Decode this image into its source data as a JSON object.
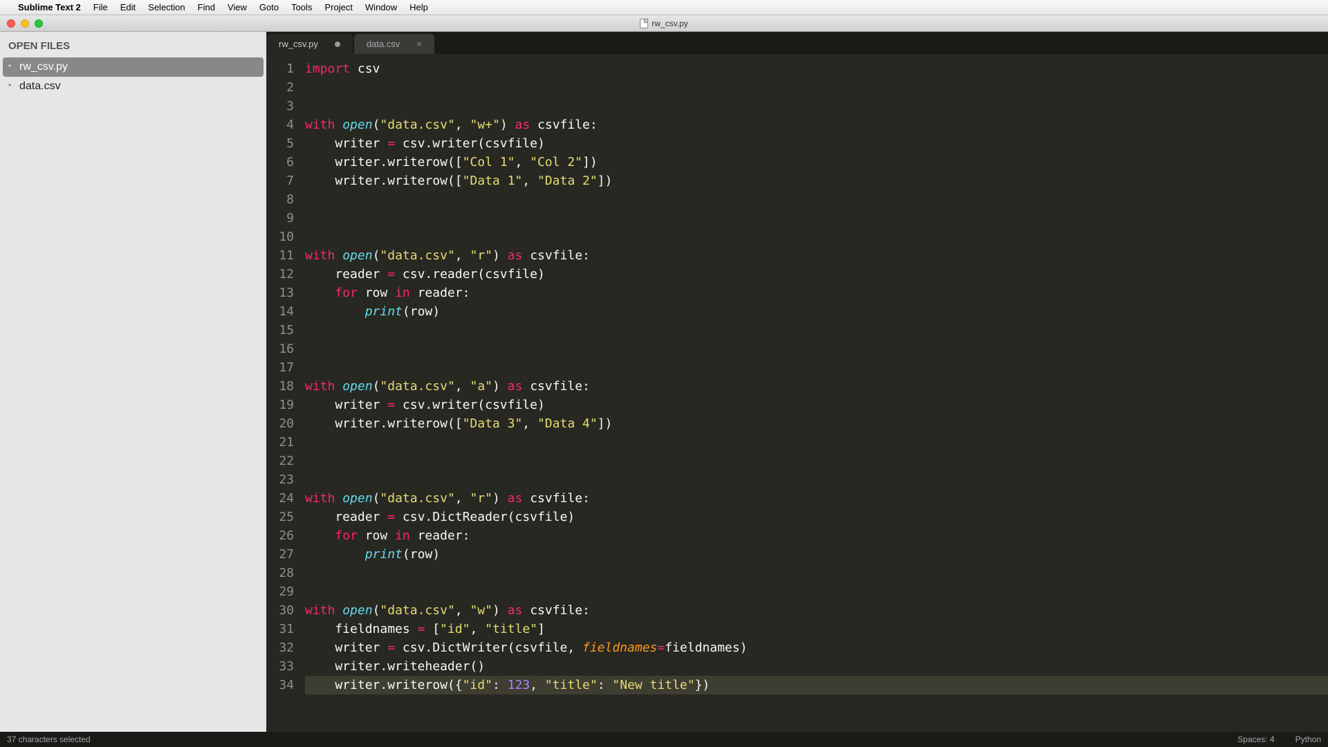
{
  "menubar": {
    "app_name": "Sublime Text 2",
    "items": [
      "File",
      "Edit",
      "Selection",
      "Find",
      "View",
      "Goto",
      "Tools",
      "Project",
      "Window",
      "Help"
    ]
  },
  "window": {
    "title": "rw_csv.py"
  },
  "sidebar": {
    "header": "OPEN FILES",
    "files": [
      {
        "name": "rw_csv.py",
        "active": true
      },
      {
        "name": "data.csv",
        "active": false
      }
    ]
  },
  "tabs": [
    {
      "label": "rw_csv.py",
      "active": true,
      "dirty": true
    },
    {
      "label": "data.csv",
      "active": false,
      "dirty": false
    }
  ],
  "statusbar": {
    "selection": "37 characters selected",
    "spaces": "Spaces: 4",
    "language": "Python"
  },
  "code": {
    "lines": [
      {
        "n": 1,
        "tokens": [
          {
            "c": "kw",
            "t": "import"
          },
          {
            "t": " csv"
          }
        ]
      },
      {
        "n": 2,
        "tokens": []
      },
      {
        "n": 3,
        "tokens": []
      },
      {
        "n": 4,
        "tokens": [
          {
            "c": "kw",
            "t": "with"
          },
          {
            "t": " "
          },
          {
            "c": "fn",
            "t": "open"
          },
          {
            "t": "("
          },
          {
            "c": "str",
            "t": "\"data.csv\""
          },
          {
            "t": ", "
          },
          {
            "c": "str",
            "t": "\"w+\""
          },
          {
            "t": ") "
          },
          {
            "c": "kw",
            "t": "as"
          },
          {
            "t": " csvfile:"
          }
        ]
      },
      {
        "n": 5,
        "tokens": [
          {
            "t": "    writer "
          },
          {
            "c": "op",
            "t": "="
          },
          {
            "t": " csv.writer(csvfile)"
          }
        ]
      },
      {
        "n": 6,
        "tokens": [
          {
            "t": "    writer.writerow(["
          },
          {
            "c": "str",
            "t": "\"Col 1\""
          },
          {
            "t": ", "
          },
          {
            "c": "str",
            "t": "\"Col 2\""
          },
          {
            "t": "])"
          }
        ]
      },
      {
        "n": 7,
        "tokens": [
          {
            "t": "    writer.writerow(["
          },
          {
            "c": "str",
            "t": "\"Data 1\""
          },
          {
            "t": ", "
          },
          {
            "c": "str",
            "t": "\"Data 2\""
          },
          {
            "t": "])"
          }
        ]
      },
      {
        "n": 8,
        "tokens": []
      },
      {
        "n": 9,
        "tokens": []
      },
      {
        "n": 10,
        "tokens": []
      },
      {
        "n": 11,
        "tokens": [
          {
            "c": "kw",
            "t": "with"
          },
          {
            "t": " "
          },
          {
            "c": "fn",
            "t": "open"
          },
          {
            "t": "("
          },
          {
            "c": "str",
            "t": "\"data.csv\""
          },
          {
            "t": ", "
          },
          {
            "c": "str",
            "t": "\"r\""
          },
          {
            "t": ") "
          },
          {
            "c": "kw",
            "t": "as"
          },
          {
            "t": " csvfile:"
          }
        ]
      },
      {
        "n": 12,
        "tokens": [
          {
            "t": "    reader "
          },
          {
            "c": "op",
            "t": "="
          },
          {
            "t": " csv.reader(csvfile)"
          }
        ]
      },
      {
        "n": 13,
        "tokens": [
          {
            "t": "    "
          },
          {
            "c": "kw",
            "t": "for"
          },
          {
            "t": " row "
          },
          {
            "c": "kw",
            "t": "in"
          },
          {
            "t": " reader:"
          }
        ]
      },
      {
        "n": 14,
        "tokens": [
          {
            "t": "        "
          },
          {
            "c": "fn",
            "t": "print"
          },
          {
            "t": "(row)"
          }
        ]
      },
      {
        "n": 15,
        "tokens": []
      },
      {
        "n": 16,
        "tokens": []
      },
      {
        "n": 17,
        "tokens": []
      },
      {
        "n": 18,
        "tokens": [
          {
            "c": "kw",
            "t": "with"
          },
          {
            "t": " "
          },
          {
            "c": "fn",
            "t": "open"
          },
          {
            "t": "("
          },
          {
            "c": "str",
            "t": "\"data.csv\""
          },
          {
            "t": ", "
          },
          {
            "c": "str",
            "t": "\"a\""
          },
          {
            "t": ") "
          },
          {
            "c": "kw",
            "t": "as"
          },
          {
            "t": " csvfile:"
          }
        ]
      },
      {
        "n": 19,
        "tokens": [
          {
            "t": "    writer "
          },
          {
            "c": "op",
            "t": "="
          },
          {
            "t": " csv.writer(csvfile)"
          }
        ]
      },
      {
        "n": 20,
        "tokens": [
          {
            "t": "    writer.writerow(["
          },
          {
            "c": "str",
            "t": "\"Data 3\""
          },
          {
            "t": ", "
          },
          {
            "c": "str",
            "t": "\"Data 4\""
          },
          {
            "t": "])"
          }
        ]
      },
      {
        "n": 21,
        "tokens": []
      },
      {
        "n": 22,
        "tokens": []
      },
      {
        "n": 23,
        "tokens": []
      },
      {
        "n": 24,
        "tokens": [
          {
            "c": "kw",
            "t": "with"
          },
          {
            "t": " "
          },
          {
            "c": "fn",
            "t": "open"
          },
          {
            "t": "("
          },
          {
            "c": "str",
            "t": "\"data.csv\""
          },
          {
            "t": ", "
          },
          {
            "c": "str",
            "t": "\"r\""
          },
          {
            "t": ") "
          },
          {
            "c": "kw",
            "t": "as"
          },
          {
            "t": " csvfile:"
          }
        ]
      },
      {
        "n": 25,
        "tokens": [
          {
            "t": "    reader "
          },
          {
            "c": "op",
            "t": "="
          },
          {
            "t": " csv.DictReader(csvfile)"
          }
        ]
      },
      {
        "n": 26,
        "tokens": [
          {
            "t": "    "
          },
          {
            "c": "kw",
            "t": "for"
          },
          {
            "t": " row "
          },
          {
            "c": "kw",
            "t": "in"
          },
          {
            "t": " reader:"
          }
        ]
      },
      {
        "n": 27,
        "tokens": [
          {
            "t": "        "
          },
          {
            "c": "fn",
            "t": "print"
          },
          {
            "t": "(row)"
          }
        ]
      },
      {
        "n": 28,
        "tokens": []
      },
      {
        "n": 29,
        "tokens": []
      },
      {
        "n": 30,
        "tokens": [
          {
            "c": "kw",
            "t": "with"
          },
          {
            "t": " "
          },
          {
            "c": "fn",
            "t": "open"
          },
          {
            "t": "("
          },
          {
            "c": "str",
            "t": "\"data.csv\""
          },
          {
            "t": ", "
          },
          {
            "c": "str",
            "t": "\"w\""
          },
          {
            "t": ") "
          },
          {
            "c": "kw",
            "t": "as"
          },
          {
            "t": " csvfile:"
          }
        ]
      },
      {
        "n": 31,
        "tokens": [
          {
            "t": "    fieldnames "
          },
          {
            "c": "op",
            "t": "="
          },
          {
            "t": " ["
          },
          {
            "c": "str",
            "t": "\"id\""
          },
          {
            "t": ", "
          },
          {
            "c": "str",
            "t": "\"title\""
          },
          {
            "t": "]"
          }
        ]
      },
      {
        "n": 32,
        "tokens": [
          {
            "t": "    writer "
          },
          {
            "c": "op",
            "t": "="
          },
          {
            "t": " csv.DictWriter(csvfile, "
          },
          {
            "c": "param",
            "t": "fieldnames"
          },
          {
            "c": "op",
            "t": "="
          },
          {
            "t": "fieldnames)"
          }
        ]
      },
      {
        "n": 33,
        "tokens": [
          {
            "t": "    writer.writeheader()"
          }
        ]
      },
      {
        "n": 34,
        "hl": true,
        "tokens": [
          {
            "t": "    writer.writerow({"
          },
          {
            "c": "str",
            "t": "\"id\""
          },
          {
            "t": ": "
          },
          {
            "c": "num",
            "t": "123"
          },
          {
            "t": ", "
          },
          {
            "c": "str",
            "t": "\"title\""
          },
          {
            "t": ": "
          },
          {
            "c": "str",
            "t": "\"New title\""
          },
          {
            "t": "})"
          }
        ]
      }
    ]
  }
}
